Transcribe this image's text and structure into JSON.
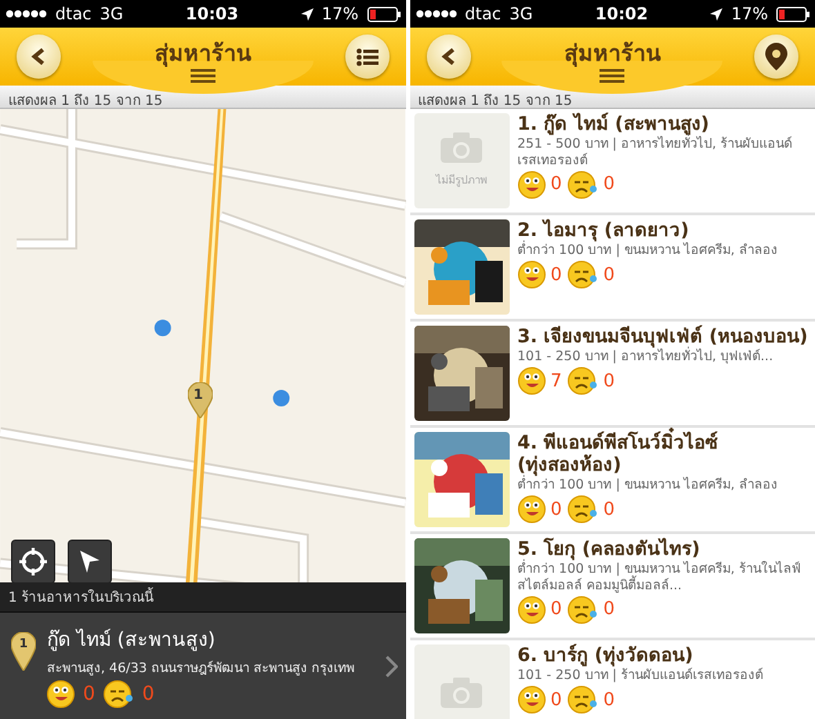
{
  "screens": [
    {
      "kind": "map",
      "status_bar": {
        "carrier": "dtac",
        "network": "3G",
        "time": "10:03",
        "battery": "17%"
      },
      "header": {
        "title": "สุ่มหาร้าน",
        "right_button": {
          "kind": "list"
        }
      },
      "result_summary": "แสดงผล 1 ถึง 15 จาก 15",
      "map": {
        "kind": "picture",
        "markers": [
          {
            "label": "1"
          }
        ]
      },
      "nearby_count": "1 ร้านอาหารในบริเวณนี้",
      "selected_place": {
        "pin": "1",
        "name": "กู๊ด ไทม์ (สะพานสูง)",
        "address": "สะพานสูง, 46/33 ถนนราษฎร์พัฒนา สะพานสูง กรุงเทพ",
        "likes": "0",
        "dislikes": "0"
      }
    },
    {
      "kind": "list",
      "status_bar": {
        "carrier": "dtac",
        "network": "3G",
        "time": "10:02",
        "battery": "17%"
      },
      "header": {
        "title": "สุ่มหาร้าน",
        "right_button": {
          "kind": "pin"
        }
      },
      "result_summary": "แสดงผล 1 ถึง 15 จาก 15",
      "restaurants": [
        {
          "image": {
            "kind": "none",
            "caption": "ไม่มีรูปภาพ"
          },
          "name": "1. กู๊ด ไทม์ (สะพานสูง)",
          "details": "251 - 500 บาท | อาหารไทยทั่วไป, ร้านผับแอนด์เรสเทอรองต์",
          "likes": "0",
          "dislikes": "0"
        },
        {
          "name": "2. ไอมารุ (ลาดยาว)",
          "details": "ต่ำกว่า 100 บาท | ขนมหวาน ไอศครีม, ลำลอง",
          "likes": "0",
          "dislikes": "0"
        },
        {
          "name": "3. เจียงขนมจีนบุฟเฟ่ต์ (หนองบอน)",
          "details": "101 - 250 บาท | อาหารไทยทั่วไป, บุฟเฟ่ต์...",
          "likes": "7",
          "dislikes": "0"
        },
        {
          "name": "4. พีแอนด์พีสโนว์มิ๋วไอซ์ (ทุ่งสองห้อง)",
          "details": "ต่ำกว่า 100 บาท | ขนมหวาน ไอศครีม, ลำลอง",
          "likes": "0",
          "dislikes": "0"
        },
        {
          "name": "5. โยกุ (คลองตันไทร)",
          "details": "ต่ำกว่า 100 บาท | ขนมหวาน ไอศครีม, ร้านในไลฟ์สไตล์มอลล์ คอมมูนิตี้มอลล์...",
          "likes": "0",
          "dislikes": "0"
        },
        {
          "image": {
            "kind": "none"
          },
          "name": "6. บาร์กู (ทุ่งวัดดอน)",
          "details": "101 - 250 บาท | ร้านผับแอนด์เรสเทอรองต์",
          "likes": "0",
          "dislikes": "0"
        }
      ]
    }
  ]
}
